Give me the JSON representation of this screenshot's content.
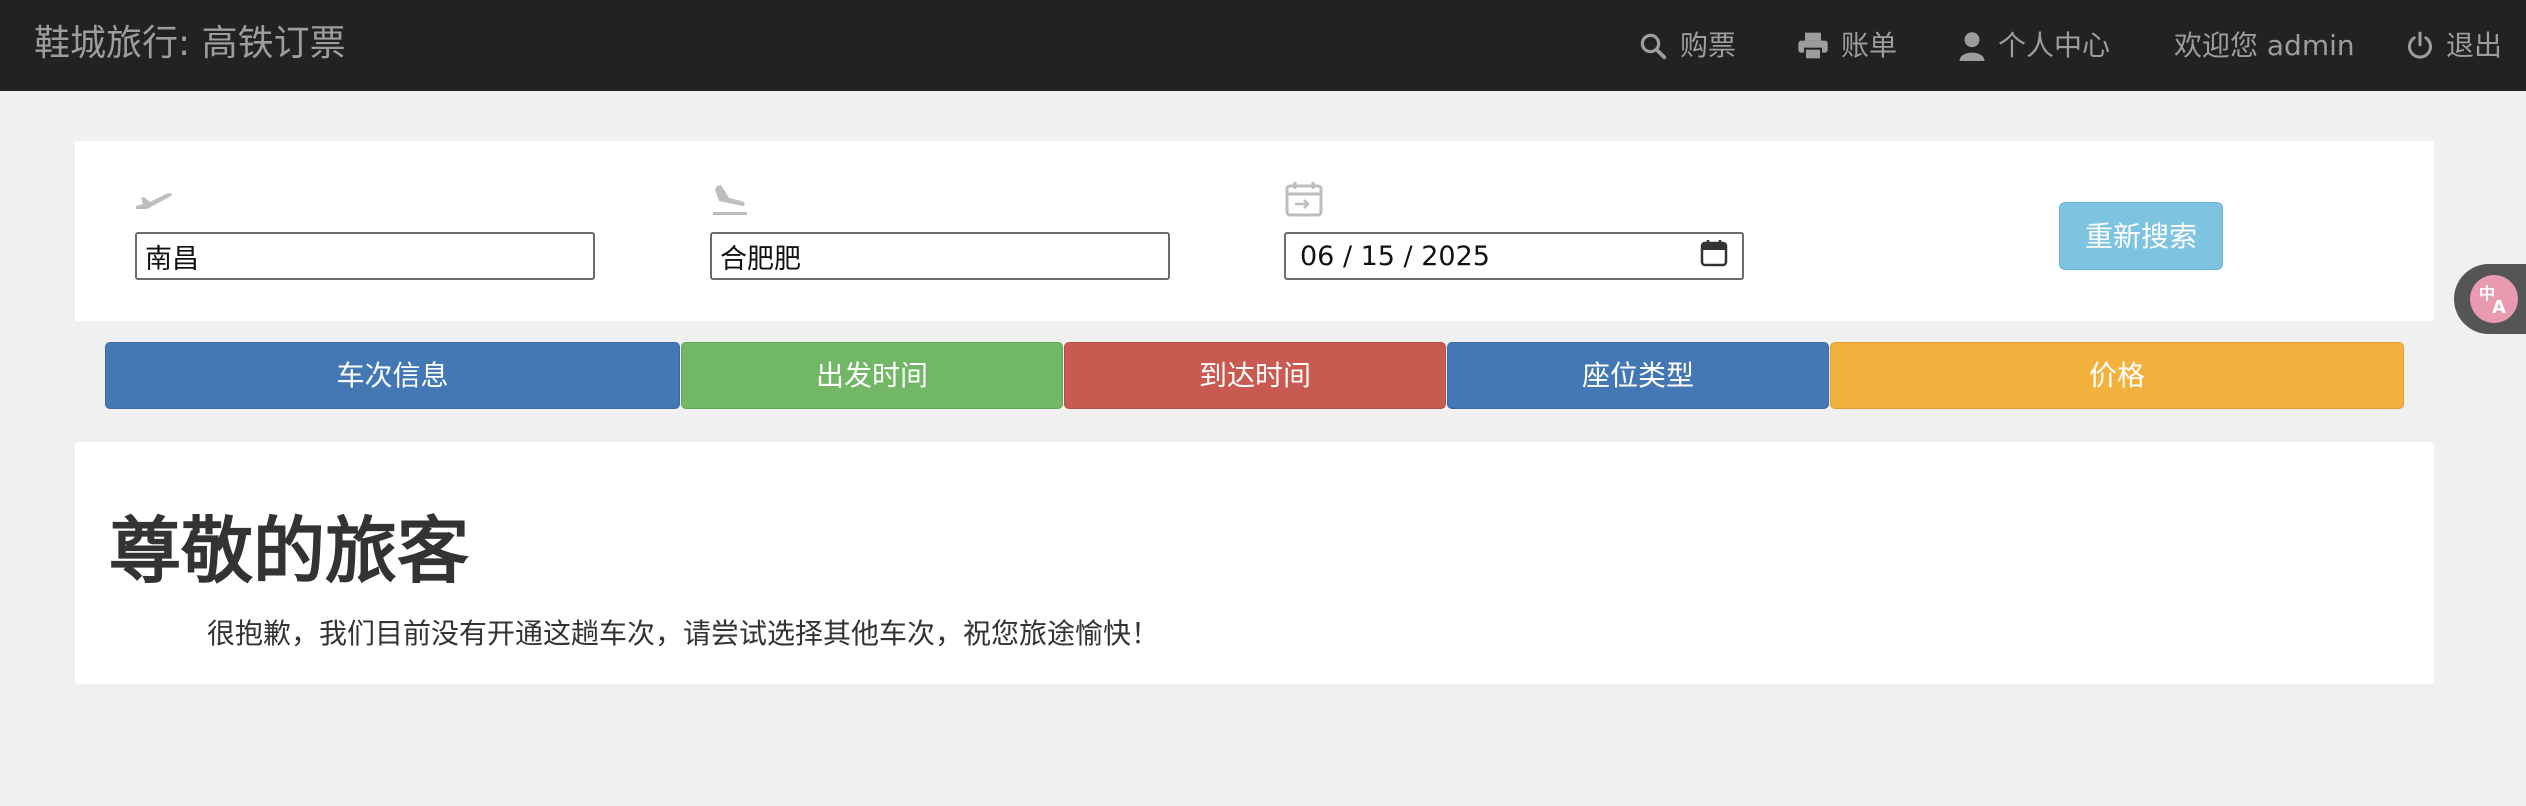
{
  "navbar": {
    "brand": "鞋城旅行: 高铁订票",
    "items": [
      {
        "icon": "search-icon",
        "label": "购票"
      },
      {
        "icon": "printer-icon",
        "label": "账单"
      },
      {
        "icon": "user-icon",
        "label": "个人中心"
      },
      {
        "icon": "",
        "label": "欢迎您 admin"
      },
      {
        "icon": "power-icon",
        "label": "退出"
      }
    ]
  },
  "search": {
    "from_icon": "plane-departure-icon",
    "from_value": "南昌",
    "to_icon": "plane-arrival-icon",
    "to_value": "合肥肥",
    "date_icon": "calendar-icon",
    "date_value": "06 / 15 / 2025",
    "research_label": "重新搜索"
  },
  "sort_buttons": [
    {
      "label": "车次信息",
      "color": "#4478b4"
    },
    {
      "label": "出发时间",
      "color": "#72b765"
    },
    {
      "label": "到达时间",
      "color": "#c95a52"
    },
    {
      "label": "座位类型",
      "color": "#4478b4"
    },
    {
      "label": "价格",
      "color": "#f2b13c"
    }
  ],
  "result": {
    "title": "尊敬的旅客",
    "message": "很抱歉，我们目前没有开通这趟车次，请尝试选择其他车次，祝您旅途愉快！"
  },
  "translate_fab": {
    "icon": "translate-icon"
  }
}
